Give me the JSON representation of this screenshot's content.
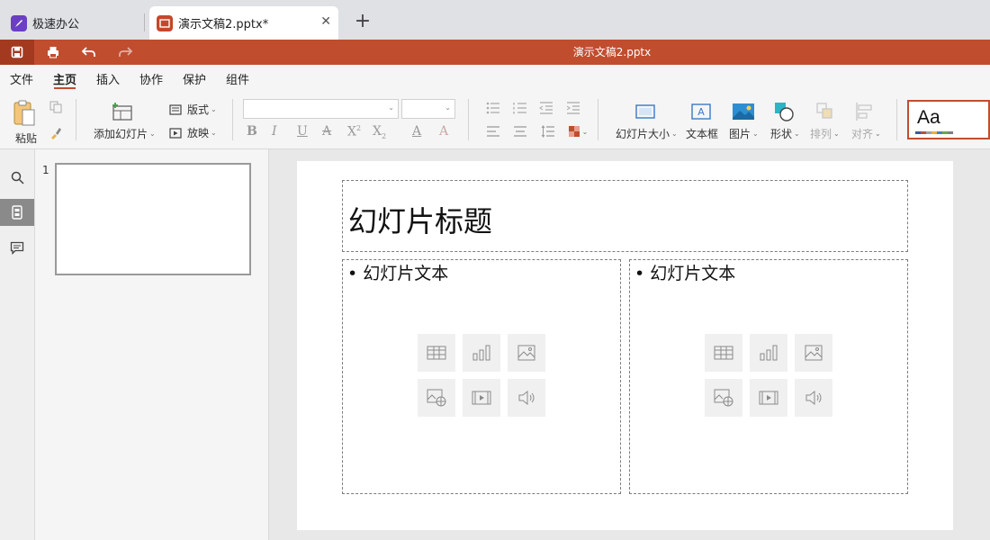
{
  "tabs": {
    "home_label": "极速办公",
    "doc_label": "演示文稿2.pptx*",
    "new_tab": "+"
  },
  "titlebar": {
    "title": "演示文稿2.pptx"
  },
  "menu": {
    "items": [
      "文件",
      "主页",
      "插入",
      "协作",
      "保护",
      "组件"
    ],
    "active": "主页"
  },
  "ribbon": {
    "paste": "粘贴",
    "add_slide": "添加幻灯片",
    "layout": "版式",
    "play": "放映",
    "font_name": "",
    "font_size": "",
    "slide_size": "幻灯片大小",
    "textbox": "文本框",
    "image": "图片",
    "shape": "形状",
    "arrange": "排列",
    "align": "对齐",
    "theme_sample": "Aa"
  },
  "thumbnails": {
    "slide_number": "1"
  },
  "slide": {
    "title": "幻灯片标题",
    "body_left": "• 幻灯片文本",
    "body_right": "• 幻灯片文本"
  },
  "colors": {
    "accent": "#c14d2f",
    "accent_dark": "#a33a1f",
    "home_icon": "#6a3fc4",
    "tab_bar": "#dfe1e5"
  }
}
